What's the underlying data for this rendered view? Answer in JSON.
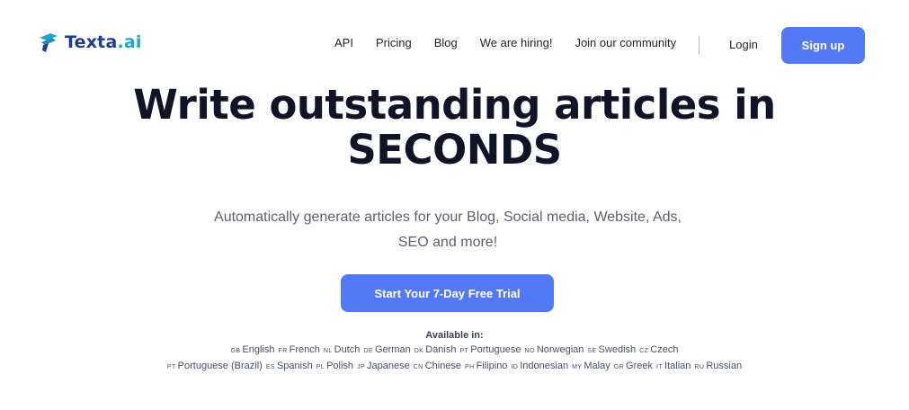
{
  "brand": {
    "name_main": "Texta",
    "name_suffix": ".ai"
  },
  "nav": {
    "items": [
      "API",
      "Pricing",
      "Blog",
      "We are hiring!",
      "Join our community"
    ],
    "login": "Login",
    "signup": "Sign up"
  },
  "hero": {
    "title_line1": "Write outstanding articles in",
    "title_line2": "SECONDS",
    "subtitle_line1": "Automatically generate articles for your Blog, Social media, Website, Ads,",
    "subtitle_line2": "SEO and more!",
    "cta": "Start Your 7-Day Free Trial"
  },
  "available": {
    "title": "Available in:",
    "row1": [
      {
        "code": "GB",
        "name": "English"
      },
      {
        "code": "FR",
        "name": "French"
      },
      {
        "code": "NL",
        "name": "Dutch"
      },
      {
        "code": "DE",
        "name": "German"
      },
      {
        "code": "DK",
        "name": "Danish"
      },
      {
        "code": "PT",
        "name": "Portuguese"
      },
      {
        "code": "NO",
        "name": "Norwegian"
      },
      {
        "code": "SE",
        "name": "Swedish"
      },
      {
        "code": "CZ",
        "name": "Czech"
      }
    ],
    "row2": [
      {
        "code": "PT",
        "name": "Portuguese (Brazil)"
      },
      {
        "code": "ES",
        "name": "Spanish"
      },
      {
        "code": "PL",
        "name": "Polish"
      },
      {
        "code": "JP",
        "name": "Japanese"
      },
      {
        "code": "CN",
        "name": "Chinese"
      },
      {
        "code": "PH",
        "name": "Filipino"
      },
      {
        "code": "ID",
        "name": "Indonesian"
      },
      {
        "code": "MY",
        "name": "Malay"
      },
      {
        "code": "GR",
        "name": "Greek"
      },
      {
        "code": "IT",
        "name": "Italian"
      },
      {
        "code": "RU",
        "name": "Russian"
      }
    ]
  },
  "colors": {
    "accent": "#5379f7",
    "logo_dark": "#1f3a93",
    "logo_light": "#1fa7c9",
    "heading": "#111427"
  }
}
